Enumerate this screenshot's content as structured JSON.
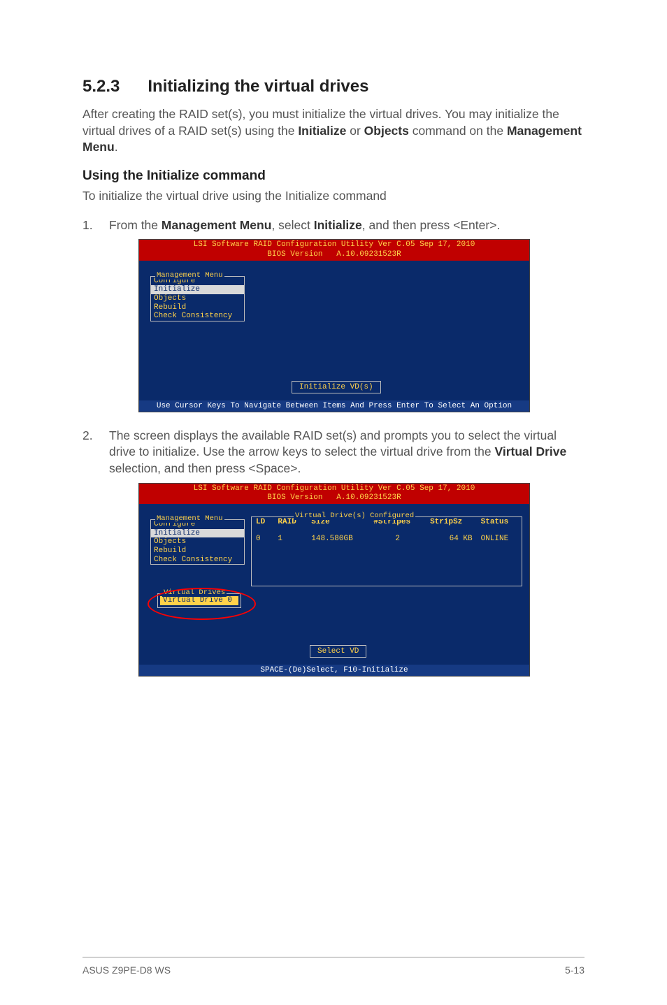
{
  "section": {
    "number": "5.2.3",
    "title": "Initializing the virtual drives"
  },
  "intro": {
    "pre": "After creating the RAID set(s), you must initialize the virtual drives. You may initialize the virtual drives of a RAID set(s) using the ",
    "b1": "Initialize",
    "mid1": " or ",
    "b2": "Objects",
    "mid2": " command on the ",
    "b3": "Management Menu",
    "post": "."
  },
  "sub1": "Using the Initialize command",
  "sub1_text": "To initialize the virtual drive using the Initialize command",
  "step1": {
    "num": "1.",
    "pre": "From the ",
    "b1": "Management Menu",
    "mid": ", select ",
    "b2": "Initialize",
    "post": ", and then press <Enter>."
  },
  "bios_title_a": "LSI Software RAID Configuration Utility Ver C.05 Sep 17, 2010",
  "bios_title_b": "BIOS Version   A.10.09231523R",
  "mgmt_menu": {
    "legend": "Management Menu",
    "items": [
      "Configure",
      "Initialize",
      "Objects",
      "Rebuild",
      "Check Consistency"
    ]
  },
  "prompt1": "Initialize VD(s)",
  "help1": "Use Cursor Keys To Navigate Between Items And Press Enter To Select An Option",
  "step2": {
    "num": "2.",
    "pre": "The screen displays the available RAID set(s) and prompts you to select the virtual drive to initialize. Use the arrow keys to select the virtual drive from the ",
    "b1": "Virtual Drive",
    "post": " selection, and then press <Space>."
  },
  "vd_group": {
    "legend": "Virtual Drive(s) Configured",
    "header": {
      "c1": "LD",
      "c2": "RAID",
      "c3": "Size",
      "c4": "#Stripes",
      "c5": "StripSz",
      "c6": "Status"
    },
    "row": {
      "c1": "0",
      "c2": "1",
      "c3": "148.580GB",
      "c4": "2",
      "c5": "64 KB",
      "c6": "ONLINE"
    }
  },
  "vd_menu": {
    "legend": "Virtual Drives",
    "item": "Virtual Drive 0"
  },
  "prompt2": "Select VD",
  "help2": "SPACE-(De)Select,  F10-Initialize",
  "footer": {
    "left": "ASUS Z9PE-D8 WS",
    "right": "5-13"
  }
}
